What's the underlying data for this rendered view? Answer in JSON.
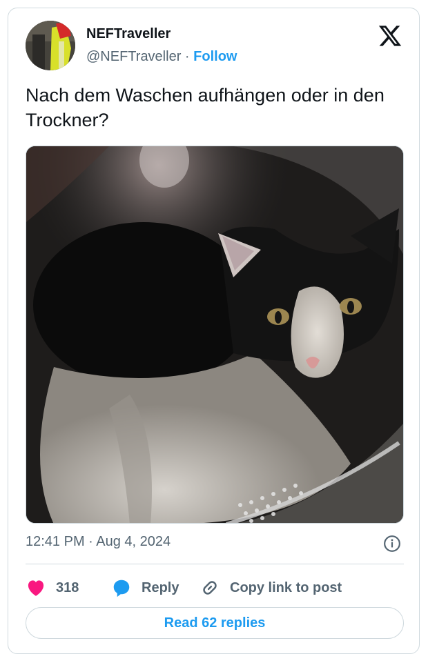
{
  "author": {
    "display_name": "NEFTraveller",
    "handle": "@NEFTraveller",
    "separator": "·",
    "follow_label": "Follow"
  },
  "tweet": {
    "text": "Nach dem Waschen aufhängen oder in den Trockner?",
    "timestamp": "12:41 PM · Aug 4, 2024"
  },
  "actions": {
    "like_count": "318",
    "reply_label": "Reply",
    "copy_link_label": "Copy link to post"
  },
  "read_replies_label": "Read 62 replies",
  "icons": {
    "logo": "x-logo-icon",
    "info": "info-icon",
    "like": "heart-icon",
    "reply": "speech-bubble-icon",
    "copy": "link-icon"
  },
  "colors": {
    "accent": "#1d9bf0",
    "like": "#f91880",
    "text": "#0f1419",
    "muted": "#536471",
    "border": "#cfd9de"
  }
}
